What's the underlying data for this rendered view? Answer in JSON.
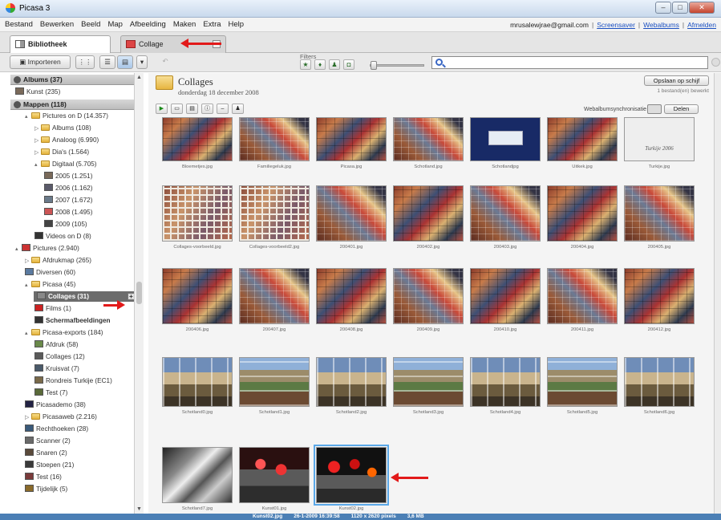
{
  "window": {
    "title": "Picasa 3"
  },
  "menu": [
    "Bestand",
    "Bewerken",
    "Beeld",
    "Map",
    "Afbeelding",
    "Maken",
    "Extra",
    "Help"
  ],
  "account": {
    "email": "mrusalewjrae@gmail.com",
    "links": [
      "Screensaver",
      "Webalbums",
      "Afmelden"
    ]
  },
  "tabs": {
    "library": "Bibliotheek",
    "collage": "Collage"
  },
  "toolbar": {
    "import": "Importeren",
    "filters_label": "Filters"
  },
  "search": {
    "value": ""
  },
  "sidebar": {
    "albums_header": "Albums (37)",
    "albums": [
      {
        "label": "Kunst (235)"
      }
    ],
    "folders_header": "Mappen (118)",
    "folders": [
      {
        "label": "Pictures on D (14.357)",
        "indent": 1,
        "expander": "▴",
        "icon": "folder"
      },
      {
        "label": "Albums (108)",
        "indent": 2,
        "expander": "▷",
        "icon": "folder"
      },
      {
        "label": "Analoog (6.990)",
        "indent": 2,
        "expander": "▷",
        "icon": "folder"
      },
      {
        "label": "Dia's (1.564)",
        "indent": 2,
        "expander": "▷",
        "icon": "folder"
      },
      {
        "label": "Digitaal (5.705)",
        "indent": 2,
        "expander": "▴",
        "icon": "folder"
      },
      {
        "label": "2005 (1.251)",
        "indent": 3,
        "icon": "thumb",
        "color": "#7a6a5a"
      },
      {
        "label": "2006 (1.162)",
        "indent": 3,
        "icon": "thumb",
        "color": "#5a5a6a"
      },
      {
        "label": "2007 (1.672)",
        "indent": 3,
        "icon": "thumb",
        "color": "#6a7a8a"
      },
      {
        "label": "2008 (1.495)",
        "indent": 3,
        "icon": "thumb",
        "color": "#c55"
      },
      {
        "label": "2009 (105)",
        "indent": 3,
        "icon": "thumb",
        "color": "#444"
      },
      {
        "label": "Videos on D (8)",
        "indent": 2,
        "icon": "thumb",
        "color": "#333"
      },
      {
        "label": "Pictures (2.940)",
        "indent": 0,
        "expander": "▴",
        "icon": "thumb",
        "color": "#c33"
      },
      {
        "label": "Afdrukmap (265)",
        "indent": 1,
        "expander": "▷",
        "icon": "folder"
      },
      {
        "label": "Diversen (60)",
        "indent": 1,
        "icon": "thumb",
        "color": "#5a7aa0"
      },
      {
        "label": "Picasa (45)",
        "indent": 1,
        "expander": "▴",
        "icon": "folder"
      },
      {
        "label": "Collages (31)",
        "indent": 2,
        "icon": "thumb",
        "color": "#888",
        "selected": true
      },
      {
        "label": "Films (1)",
        "indent": 2,
        "icon": "thumb",
        "color": "#c22"
      },
      {
        "label": "Schermafbeeldingen",
        "indent": 2,
        "icon": "thumb",
        "color": "#333",
        "bold": true
      },
      {
        "label": "Picasa-exports (184)",
        "indent": 1,
        "expander": "▴",
        "icon": "folder"
      },
      {
        "label": "Afdruk (58)",
        "indent": 2,
        "icon": "thumb",
        "color": "#6a8a4a"
      },
      {
        "label": "Collages (12)",
        "indent": 2,
        "icon": "thumb",
        "color": "#5a5a5a"
      },
      {
        "label": "Kruisvat (7)",
        "indent": 2,
        "icon": "thumb",
        "color": "#4a5a6a"
      },
      {
        "label": "Rondreis Turkije (EC1)",
        "indent": 2,
        "icon": "thumb",
        "color": "#7a6a4a"
      },
      {
        "label": "Test (7)",
        "indent": 2,
        "icon": "thumb",
        "color": "#5a6a3a"
      },
      {
        "label": "Picasademo (38)",
        "indent": 1,
        "icon": "thumb",
        "color": "#224"
      },
      {
        "label": "Picasaweb (2.216)",
        "indent": 1,
        "expander": "▷",
        "icon": "folder"
      },
      {
        "label": "Rechthoeken (28)",
        "indent": 1,
        "icon": "thumb",
        "color": "#3a5a7a"
      },
      {
        "label": "Scanner (2)",
        "indent": 1,
        "icon": "thumb",
        "color": "#6a6a6a"
      },
      {
        "label": "Snaren (2)",
        "indent": 1,
        "icon": "thumb",
        "color": "#5a4a3a"
      },
      {
        "label": "Stoepen (21)",
        "indent": 1,
        "icon": "thumb",
        "color": "#3a3a3a"
      },
      {
        "label": "Test (16)",
        "indent": 1,
        "icon": "thumb",
        "color": "#7a3a3a"
      },
      {
        "label": "Tijdelijk (5)",
        "indent": 1,
        "icon": "thumb",
        "color": "#8a6a2a"
      }
    ]
  },
  "folder_view": {
    "title": "Collages",
    "date": "donderdag 18 december 2008",
    "save_button": "Opslaan op schijf",
    "selected_count": "1 bestand(en) bewerkt",
    "sync_label": "Webalbumsynchronisatie",
    "share_button": "Delen"
  },
  "photos": [
    {
      "name": "Bloemetjes.jpg",
      "style": "p-mosaic"
    },
    {
      "name": "Familiegeluk.jpg",
      "style": "p-mosaic2"
    },
    {
      "name": "Picasa.jpg",
      "style": "p-mosaic"
    },
    {
      "name": "Schotland.jpg",
      "style": "p-mosaic2"
    },
    {
      "name": "Schotlandjpg",
      "style": "p-blue"
    },
    {
      "name": "Uitkek.jpg",
      "style": "p-mosaic"
    },
    {
      "name": "Turkije.jpg",
      "style": "p-white",
      "text": "Turkije 2006"
    },
    {
      "name": "Collages-voorbeeld.jpg",
      "style": "p-grid"
    },
    {
      "name": "Collages-voorbeeld2.jpg",
      "style": "p-grid"
    },
    {
      "name": "200401.jpg",
      "style": "p-mosaic2"
    },
    {
      "name": "200402.jpg",
      "style": "p-mosaic"
    },
    {
      "name": "200403.jpg",
      "style": "p-mosaic2"
    },
    {
      "name": "200404.jpg",
      "style": "p-mosaic"
    },
    {
      "name": "200405.jpg",
      "style": "p-mosaic2"
    },
    {
      "name": "200406.jpg",
      "style": "p-mosaic"
    },
    {
      "name": "200407.jpg",
      "style": "p-mosaic2"
    },
    {
      "name": "200408.jpg",
      "style": "p-mosaic"
    },
    {
      "name": "200409.jpg",
      "style": "p-mosaic2"
    },
    {
      "name": "200410.jpg",
      "style": "p-mosaic"
    },
    {
      "name": "200411.jpg",
      "style": "p-mosaic2"
    },
    {
      "name": "200412.jpg",
      "style": "p-mosaic"
    },
    {
      "name": "Schotland0.jpg",
      "style": "p-landscape"
    },
    {
      "name": "Schotland1.jpg",
      "style": "p-landscape2"
    },
    {
      "name": "Schotland2.jpg",
      "style": "p-landscape"
    },
    {
      "name": "Schotland3.jpg",
      "style": "p-landscape2"
    },
    {
      "name": "Schotland4.jpg",
      "style": "p-landscape"
    },
    {
      "name": "Schotland5.jpg",
      "style": "p-landscape2"
    },
    {
      "name": "Schotland6.jpg",
      "style": "p-landscape"
    },
    {
      "name": "Schotland7.jpg",
      "style": "p-dark"
    },
    {
      "name": "Kunst01.jpg",
      "style": "p-red"
    },
    {
      "name": "Kunst02.jpg",
      "style": "p-red2",
      "selected": true
    }
  ],
  "status": {
    "file": "Kunst02.jpg",
    "date": "26-1-2009 16:39:58",
    "dims": "1120 x 2620 pixels",
    "size": "3,6 MB"
  },
  "colors": {
    "accent": "#e21a1a",
    "status_bar": "#4b7fb5",
    "selection": "#6c6c6c"
  }
}
